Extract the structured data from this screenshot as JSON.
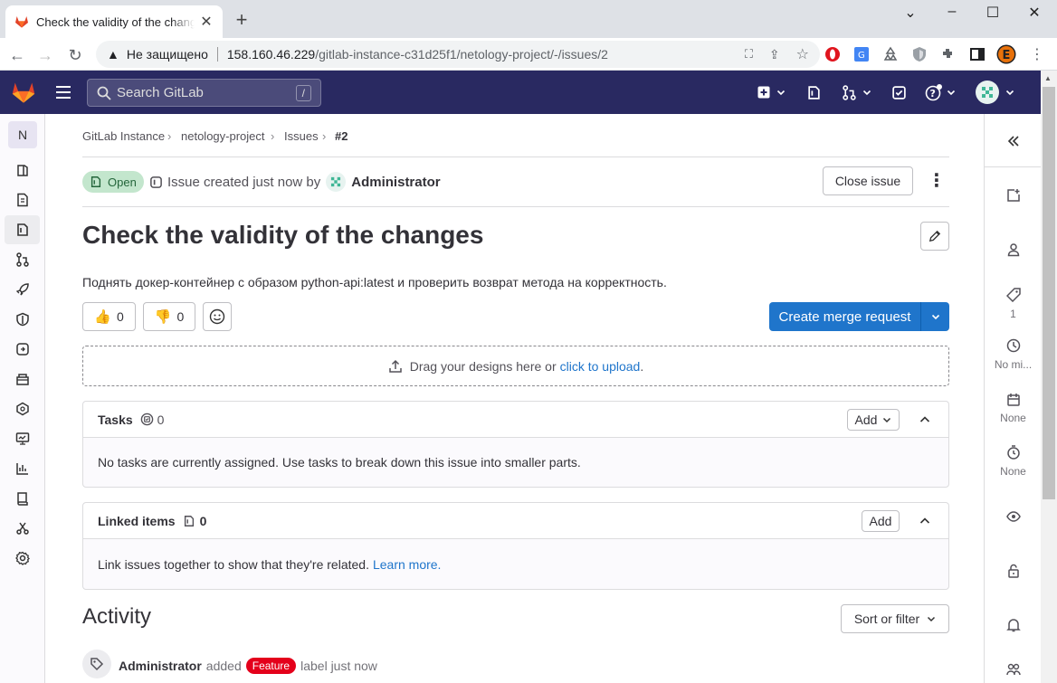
{
  "browser": {
    "tab_title": "Check the validity of the changes",
    "security_label": "Не защищено",
    "url_host": "158.160.46.229",
    "url_path": "/gitlab-instance-c31d25f1/netology-project/-/issues/2"
  },
  "gitlab": {
    "search_placeholder": "Search GitLab",
    "search_shortcut": "/",
    "project_initial": "N"
  },
  "breadcrumb": [
    "GitLab Instance",
    "netology-project",
    "Issues",
    "#2"
  ],
  "issue": {
    "status": "Open",
    "created_text": "Issue created just now by",
    "author": "Administrator",
    "close_label": "Close issue",
    "title": "Check the validity of the changes",
    "description": "Поднять докер-контейнер с образом python-api:latest и проверить возврат метода на корректность.",
    "thumbs_up": "0",
    "thumbs_down": "0",
    "create_mr_label": "Create merge request",
    "design_drop_text": "Drag your designs here or",
    "design_upload_link": "click to upload",
    "design_period": "."
  },
  "tasks": {
    "title": "Tasks",
    "count": "0",
    "add_label": "Add",
    "empty_text": "No tasks are currently assigned. Use tasks to break down this issue into smaller parts."
  },
  "linked": {
    "title": "Linked items",
    "count": "0",
    "add_label": "Add",
    "empty_text": "Link issues together to show that they're related.",
    "learn_more": "Learn more."
  },
  "activity": {
    "title": "Activity",
    "sort_label": "Sort or filter",
    "entry_author": "Administrator",
    "entry_action": "added",
    "entry_label": "Feature",
    "entry_suffix": "label just now"
  },
  "right_sidebar": {
    "labels_count": "1",
    "milestone": "No mi...",
    "due_date": "None",
    "time_tracking": "None"
  },
  "colors": {
    "gitlab_nav": "#292961",
    "primary": "#1f75cb",
    "open_badge_bg": "#c3e6cd",
    "open_badge_text": "#24663b",
    "feature_label": "#e4001b"
  }
}
